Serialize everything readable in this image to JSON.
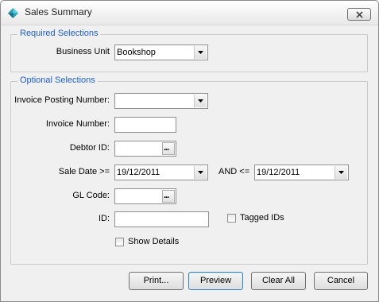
{
  "window": {
    "title": "Sales Summary"
  },
  "required_group": {
    "legend": "Required Selections",
    "business_unit": {
      "label": "Business Unit",
      "value": "Bookshop"
    }
  },
  "optional_group": {
    "legend": "Optional Selections",
    "invoice_posting_number": {
      "label": "Invoice Posting Number:",
      "value": ""
    },
    "invoice_number": {
      "label": "Invoice Number:",
      "value": ""
    },
    "debtor_id": {
      "label": "Debtor ID:",
      "value": "",
      "button": "..."
    },
    "sale_date": {
      "label": "Sale Date >=",
      "from_value": "19/12/2011",
      "and_label": "AND <=",
      "to_value": "19/12/2011"
    },
    "gl_code": {
      "label": "GL Code:",
      "value": "",
      "button": "..."
    },
    "id": {
      "label": "ID:",
      "value": ""
    },
    "tagged_ids": {
      "label": "Tagged IDs",
      "checked": false
    },
    "show_details": {
      "label": "Show Details",
      "checked": false
    }
  },
  "buttons": {
    "print": "Print...",
    "preview": "Preview",
    "clear_all": "Clear All",
    "cancel": "Cancel"
  },
  "colors": {
    "legend": "#1e5fc6",
    "background": "#f0f0f0"
  }
}
